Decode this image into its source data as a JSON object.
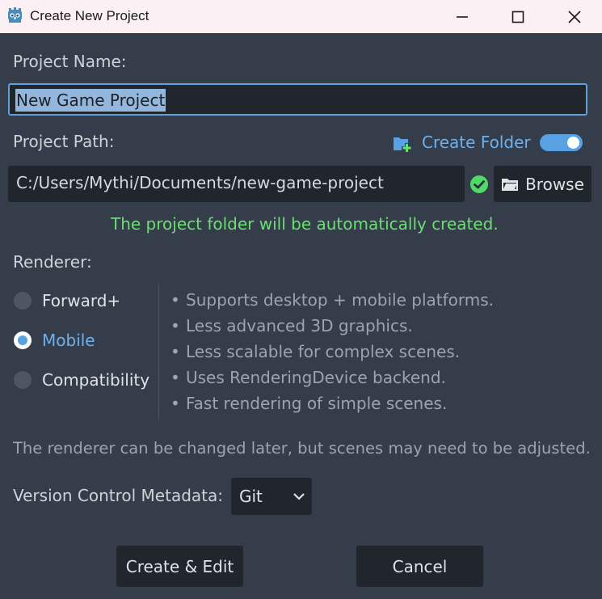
{
  "window": {
    "title": "Create New Project",
    "controls": [
      "minimize-icon",
      "maximize-icon",
      "close-icon"
    ]
  },
  "project_name": {
    "label": "Project Name:",
    "value": "New Game Project"
  },
  "project_path": {
    "label": "Project Path:",
    "create_folder_label": "Create Folder",
    "create_folder_enabled": true,
    "value": "C:/Users/Mythi/Documents/new-game-project",
    "status_icon": "check-circle-icon",
    "browse_label": "Browse",
    "status_message": "The project folder will be automatically created."
  },
  "renderer": {
    "label": "Renderer:",
    "options": [
      {
        "label": "Forward+",
        "selected": false
      },
      {
        "label": "Mobile",
        "selected": true
      },
      {
        "label": "Compatibility",
        "selected": false
      }
    ],
    "bullet": "•",
    "features": [
      "Supports desktop + mobile platforms.",
      "Less advanced 3D graphics.",
      "Less scalable for complex scenes.",
      "Uses RenderingDevice backend.",
      "Fast rendering of simple scenes."
    ],
    "note": "The renderer can be changed later, but scenes may need to be adjusted."
  },
  "version_control": {
    "label": "Version Control Metadata:",
    "selected": "Git"
  },
  "actions": {
    "create_label": "Create & Edit",
    "cancel_label": "Cancel"
  },
  "colors": {
    "background": "#363d4a",
    "field": "#21252c",
    "accent": "#5aa1e4",
    "success": "#68e06f",
    "titlebar": "#fbf1f5"
  }
}
